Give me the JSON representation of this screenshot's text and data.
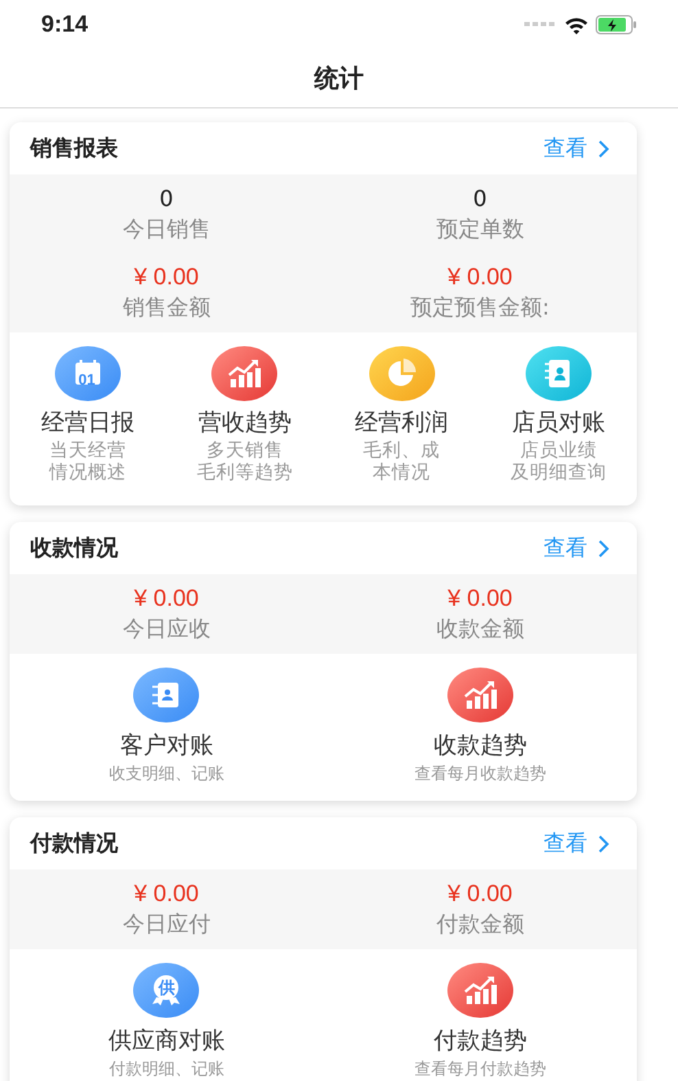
{
  "status_bar": {
    "time": "9:14"
  },
  "nav": {
    "title": "统计"
  },
  "sections": [
    {
      "title": "销售报表",
      "link": "查看",
      "stats": [
        {
          "value": "0",
          "label": "今日销售",
          "kind": "count"
        },
        {
          "value": "0",
          "label": "预定单数",
          "kind": "count"
        },
        {
          "value": "¥ 0.00",
          "label": "销售金额",
          "kind": "amount"
        },
        {
          "value": "¥ 0.00",
          "label": "预定预售金额:",
          "kind": "amount"
        }
      ],
      "items": [
        {
          "kind": "calendar",
          "badge": "01",
          "label": "经营日报",
          "desc": [
            "当天经营",
            "情况概述"
          ]
        },
        {
          "kind": "trend",
          "label": "营收趋势",
          "desc": [
            "多天销售",
            "毛利等趋势"
          ]
        },
        {
          "kind": "pie",
          "label": "经营利润",
          "desc": [
            "毛利、成",
            "本情况"
          ]
        },
        {
          "kind": "contact",
          "label": "店员对账",
          "desc": [
            "店员业绩",
            "及明细查询"
          ]
        }
      ]
    },
    {
      "title": "收款情况",
      "link": "查看",
      "stats": [
        {
          "value": "¥ 0.00",
          "label": "今日应收",
          "kind": "amount"
        },
        {
          "value": "¥ 0.00",
          "label": "收款金额",
          "kind": "amount"
        }
      ],
      "items": [
        {
          "kind": "customers",
          "label": "客户对账",
          "desc": [
            "收支明细、记账"
          ]
        },
        {
          "kind": "trend",
          "label": "收款趋势",
          "desc": [
            "查看每月收款趋势"
          ]
        }
      ]
    },
    {
      "title": "付款情况",
      "link": "查看",
      "stats": [
        {
          "value": "¥ 0.00",
          "label": "今日应付",
          "kind": "amount"
        },
        {
          "value": "¥ 0.00",
          "label": "付款金额",
          "kind": "amount"
        }
      ],
      "items": [
        {
          "kind": "supplier",
          "badge": "供",
          "label": "供应商对账",
          "desc": [
            "付款明细、记账"
          ]
        },
        {
          "kind": "trend",
          "label": "付款趋势",
          "desc": [
            "查看每月付款趋势"
          ]
        }
      ]
    }
  ]
}
